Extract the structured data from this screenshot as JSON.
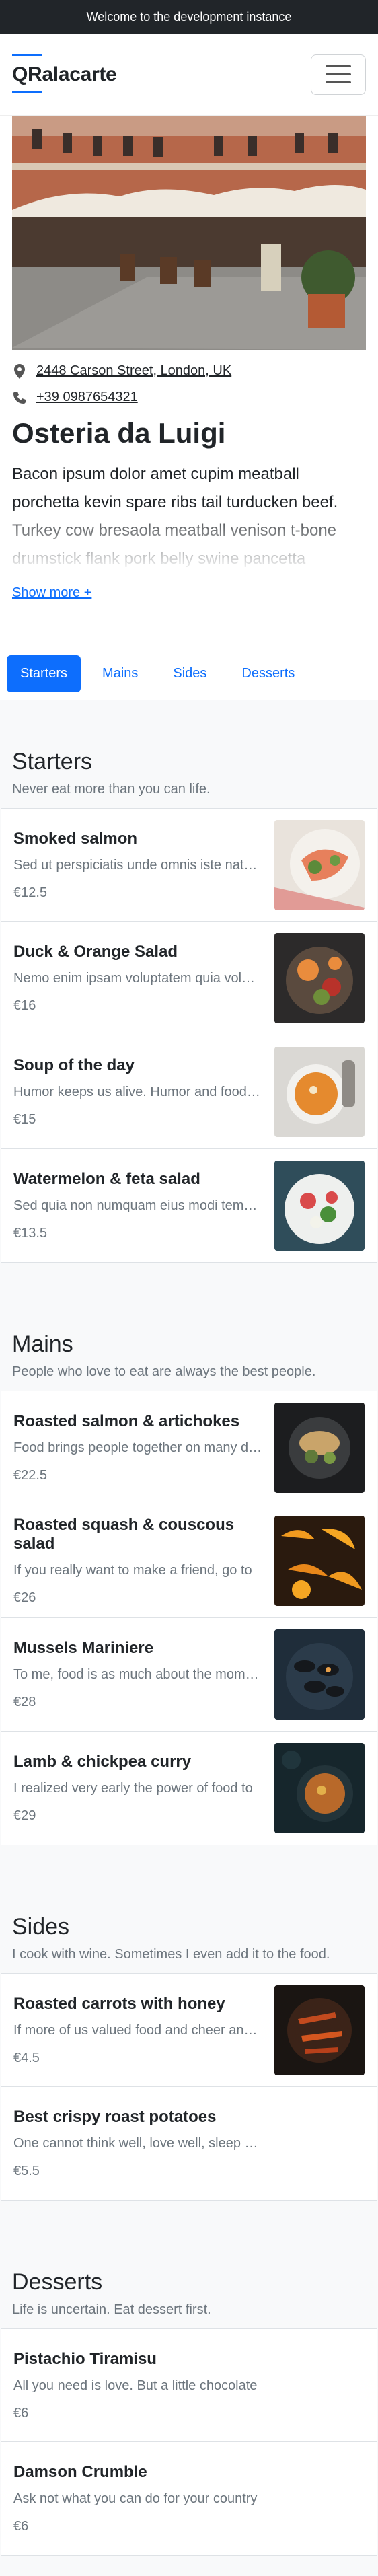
{
  "banner": "Welcome to the development instance",
  "brand": "QRalacarte",
  "contact": {
    "address": "2448 Carson Street, London, UK",
    "phone": "+39 0987654321"
  },
  "restaurant": {
    "name": "Osteria da Luigi",
    "description": "Bacon ipsum dolor amet cupim meatball porchetta kevin spare ribs tail turducken beef. Turkey cow bresaola meatball venison t-bone drumstick flank pork belly swine pancetta",
    "show_more": "Show more +"
  },
  "tabs": [
    {
      "label": "Starters"
    },
    {
      "label": "Mains"
    },
    {
      "label": "Sides"
    },
    {
      "label": "Desserts"
    }
  ],
  "sections": [
    {
      "title": "Starters",
      "subtitle": "Never eat more than you can life.",
      "items": [
        {
          "name": "Smoked salmon",
          "desc": "Sed ut perspiciatis unde omnis iste natus error",
          "price": "€12.5"
        },
        {
          "name": "Duck & Orange Salad",
          "desc": "Nemo enim ipsam voluptatem quia voluptas sit",
          "price": "€16"
        },
        {
          "name": "Soup of the day",
          "desc": "Humor keeps us alive. Humor and food. Don't",
          "price": "€15"
        },
        {
          "name": "Watermelon & feta salad",
          "desc": "Sed quia non numquam eius modi tempora",
          "price": "€13.5"
        }
      ]
    },
    {
      "title": "Mains",
      "subtitle": "People who love to eat are always the best people.",
      "items": [
        {
          "name": "Roasted salmon & artichokes",
          "desc": "Food brings people together on many different",
          "price": "€22.5"
        },
        {
          "name": "Roasted squash & couscous salad",
          "desc": "If you really want to make a friend, go to",
          "price": "€26"
        },
        {
          "name": "Mussels Mariniere",
          "desc": "To me, food is as much about the moment",
          "price": "€28"
        },
        {
          "name": "Lamb & chickpea curry",
          "desc": "I realized very early the power of food to",
          "price": "€29"
        }
      ]
    },
    {
      "title": "Sides",
      "subtitle": "I cook with wine. Sometimes I even add it to the food.",
      "items": [
        {
          "name": "Roasted carrots with honey",
          "desc": "If more of us valued food and cheer and song",
          "price": "€4.5"
        },
        {
          "name": "Best crispy roast potatoes",
          "desc": "One cannot think well, love well, sleep well",
          "price": "€5.5"
        }
      ]
    },
    {
      "title": "Desserts",
      "subtitle": "Life is uncertain. Eat dessert first.",
      "items": [
        {
          "name": "Pistachio Tiramisu",
          "desc": "All you need is love. But a little chocolate",
          "price": "€6"
        },
        {
          "name": "Damson Crumble",
          "desc": "Ask not what you can do for your country",
          "price": "€6"
        }
      ]
    }
  ],
  "colors": {
    "accent": "#0d6efd",
    "banner_bg": "#212529",
    "muted": "#6c757d"
  }
}
